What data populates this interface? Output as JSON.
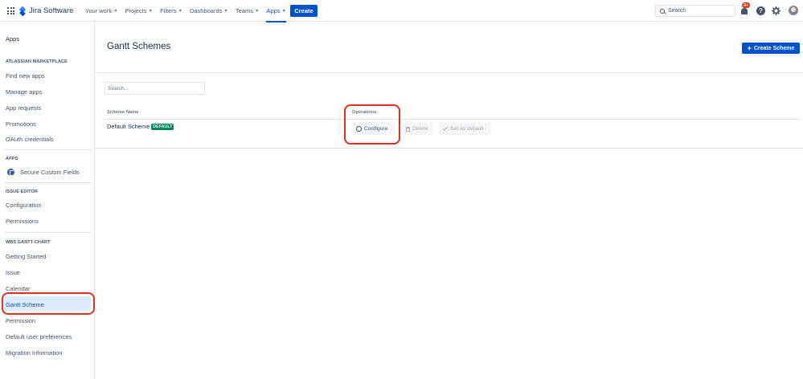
{
  "topnav": {
    "logo": "Jira Software",
    "items": [
      {
        "label": "Your work",
        "active": false
      },
      {
        "label": "Projects",
        "active": false
      },
      {
        "label": "Filters",
        "active": false
      },
      {
        "label": "Dashboards",
        "active": false
      },
      {
        "label": "Teams",
        "active": false
      },
      {
        "label": "Apps",
        "active": true
      }
    ],
    "create_label": "Create",
    "search_placeholder": "Search",
    "notification_badge": "9+",
    "help_glyph": "?",
    "icons": [
      "app-switcher-icon",
      "jira-logo-icon",
      "search-icon",
      "notification-bell-icon",
      "help-icon",
      "settings-gear-icon",
      "user-avatar"
    ]
  },
  "sidebar": {
    "title": "Apps",
    "sections": [
      {
        "heading": "ATLASSIAN MARKETPLACE",
        "items": [
          "Find new apps",
          "Manage apps",
          "App requests",
          "Promotions",
          "OAuth credentials"
        ]
      },
      {
        "heading": "APPS",
        "items": [
          "Secure Custom Fields"
        ]
      },
      {
        "heading": "ISSUE EDITOR",
        "items": [
          "Configuration",
          "Permissions"
        ]
      },
      {
        "heading": "WBS GANTT-CHART",
        "items": [
          "Getting Started",
          "Issue",
          "Calendar",
          "Gantt Scheme",
          "Permission",
          "Default user preferences",
          "Migration Information"
        ]
      }
    ],
    "selected_item": "Gantt Scheme"
  },
  "main": {
    "title": "Gantt Schemes",
    "create_scheme_label": "Create Scheme",
    "search_placeholder": "Search...",
    "columns": [
      "Scheme Name",
      "Operations"
    ],
    "rows": [
      {
        "name": "Default Scheme",
        "lozenge": "DEFAULT",
        "operations": {
          "configure": "Configure",
          "delete": "Delete",
          "set_default": "Set as default"
        }
      }
    ]
  },
  "colors": {
    "primary": "#0052cc",
    "lozenge": "#00875a",
    "annotation": "#e0301e",
    "selected_bg": "#deebff"
  }
}
